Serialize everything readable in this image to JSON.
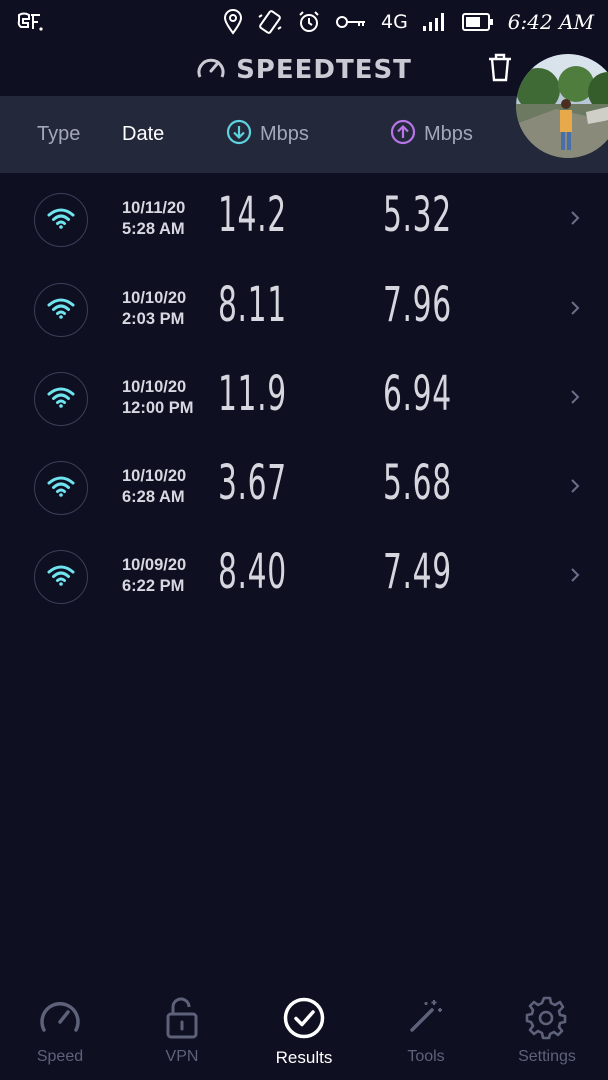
{
  "status_bar": {
    "network_label": "4G",
    "time": "6:42 AM"
  },
  "header": {
    "title": "SPEEDTEST"
  },
  "columns": {
    "type": "Type",
    "date": "Date",
    "download_unit": "Mbps",
    "upload_unit": "Mbps"
  },
  "results": [
    {
      "type_icon": "wifi-icon",
      "date": "10/11/20",
      "time": "5:28 AM",
      "download": "14.2",
      "upload": "5.32"
    },
    {
      "type_icon": "wifi-icon",
      "date": "10/10/20",
      "time": "2:03 PM",
      "download": "8.11",
      "upload": "7.96"
    },
    {
      "type_icon": "wifi-icon",
      "date": "10/10/20",
      "time": "12:00 PM",
      "download": "11.9",
      "upload": "6.94"
    },
    {
      "type_icon": "wifi-icon",
      "date": "10/10/20",
      "time": "6:28 AM",
      "download": "3.67",
      "upload": "5.68"
    },
    {
      "type_icon": "wifi-icon",
      "date": "10/09/20",
      "time": "6:22 PM",
      "download": "8.40",
      "upload": "7.49"
    }
  ],
  "nav": {
    "items": [
      {
        "label": "Speed",
        "icon": "speedometer-icon"
      },
      {
        "label": "VPN",
        "icon": "lock-icon"
      },
      {
        "label": "Results",
        "icon": "check-circle-icon"
      },
      {
        "label": "Tools",
        "icon": "magic-wand-icon"
      },
      {
        "label": "Settings",
        "icon": "gear-icon"
      }
    ],
    "active": "Results"
  },
  "colors": {
    "background": "#0f0f22",
    "header_band": "#24283b",
    "download_accent": "#5ed3e0",
    "upload_accent": "#b676e8",
    "wifi_icon": "#6fe4ee",
    "nav_inactive": "#5d627a"
  }
}
